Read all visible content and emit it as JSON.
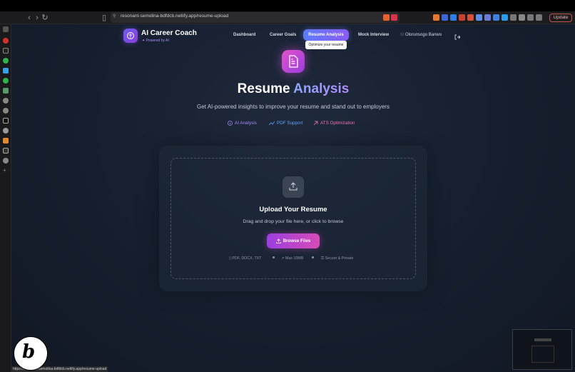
{
  "browser": {
    "url": "resonant-semolina-bdfdcb.netlify.app/resume-upload",
    "update_label": "Update",
    "status_url": "https://resonant-semolina-bdfdcb.netlify.app/resume-upload"
  },
  "header": {
    "brand_title": "AI Career Coach",
    "brand_subtitle": "Powered by AI",
    "nav": [
      "Dashboard",
      "Career Goals",
      "Resume Analysis",
      "Mock Interview"
    ],
    "active_nav": "Resume Analysis",
    "tooltip": "Optimize your resume",
    "user_name": "Olorunsogo Banwo"
  },
  "hero": {
    "title_part1": "Resume",
    "title_part2": "Analysis",
    "subtitle": "Get AI-powered insights to improve your resume and stand out to employers",
    "features": [
      {
        "label": "AI Analysis",
        "color": "#a78bfa",
        "icon": "info-icon"
      },
      {
        "label": "PDF Support",
        "color": "#60a5fa",
        "icon": "trend-icon"
      },
      {
        "label": "ATS Optimization",
        "color": "#f472b6",
        "icon": "target-icon"
      }
    ]
  },
  "upload": {
    "title": "Upload Your Resume",
    "subtitle": "Drag and drop your file here, or click to browse",
    "button_label": "Browse Files",
    "meta": [
      "PDF, DOCX, TXT",
      "Max 10MB",
      "Secure & Private"
    ]
  },
  "colors": {
    "accent": "#8b5cf6",
    "brand_gradient_start": "#6d5df5",
    "button_gradient_start": "#9b3fe0",
    "button_gradient_end": "#d84bb8"
  }
}
